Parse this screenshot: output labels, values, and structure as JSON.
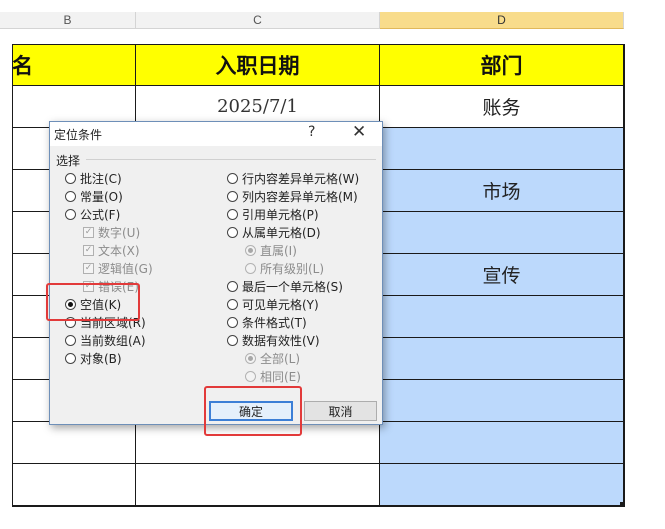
{
  "columns": [
    {
      "letter": "B",
      "selected": false
    },
    {
      "letter": "C",
      "selected": false
    },
    {
      "letter": "D",
      "selected": true
    }
  ],
  "header_row": {
    "b": "名",
    "c": "入职日期",
    "d": "部门"
  },
  "rows": [
    {
      "c": "2025/7/1",
      "d": "账务"
    },
    {
      "c": "",
      "d": ""
    },
    {
      "c": "",
      "d": "市场"
    },
    {
      "c": "",
      "d": ""
    },
    {
      "c": "",
      "d": "宣传"
    },
    {
      "c": "",
      "d": ""
    },
    {
      "c": "",
      "d": ""
    },
    {
      "c": "",
      "d": ""
    },
    {
      "c": "",
      "d": ""
    },
    {
      "c": "",
      "d": ""
    }
  ],
  "dialog": {
    "title": "定位条件",
    "help": "?",
    "close": "✕",
    "group_label": "选择",
    "left_options": [
      {
        "label": "批注(C)",
        "kind": "radio",
        "checked": false,
        "disabled": false
      },
      {
        "label": "常量(O)",
        "kind": "radio",
        "checked": false,
        "disabled": false
      },
      {
        "label": "公式(F)",
        "kind": "radio",
        "checked": false,
        "disabled": false
      },
      {
        "label": "数字(U)",
        "kind": "check",
        "checked": true,
        "disabled": true
      },
      {
        "label": "文本(X)",
        "kind": "check",
        "checked": true,
        "disabled": true
      },
      {
        "label": "逻辑值(G)",
        "kind": "check",
        "checked": true,
        "disabled": true
      },
      {
        "label": "错误(E)",
        "kind": "check",
        "checked": true,
        "disabled": true
      },
      {
        "label": "空值(K)",
        "kind": "radio",
        "checked": true,
        "disabled": false
      },
      {
        "label": "当前区域(R)",
        "kind": "radio",
        "checked": false,
        "disabled": false
      },
      {
        "label": "当前数组(A)",
        "kind": "radio",
        "checked": false,
        "disabled": false
      },
      {
        "label": "对象(B)",
        "kind": "radio",
        "checked": false,
        "disabled": false
      }
    ],
    "right_options": [
      {
        "label": "行内容差异单元格(W)",
        "kind": "radio",
        "checked": false,
        "disabled": false
      },
      {
        "label": "列内容差异单元格(M)",
        "kind": "radio",
        "checked": false,
        "disabled": false
      },
      {
        "label": "引用单元格(P)",
        "kind": "radio",
        "checked": false,
        "disabled": false
      },
      {
        "label": "从属单元格(D)",
        "kind": "radio",
        "checked": false,
        "disabled": false
      },
      {
        "label": "直属(I)",
        "kind": "radio",
        "checked": true,
        "disabled": true
      },
      {
        "label": "所有级别(L)",
        "kind": "radio",
        "checked": false,
        "disabled": true
      },
      {
        "label": "最后一个单元格(S)",
        "kind": "radio",
        "checked": false,
        "disabled": false
      },
      {
        "label": "可见单元格(Y)",
        "kind": "radio",
        "checked": false,
        "disabled": false
      },
      {
        "label": "条件格式(T)",
        "kind": "radio",
        "checked": false,
        "disabled": false
      },
      {
        "label": "数据有效性(V)",
        "kind": "radio",
        "checked": false,
        "disabled": false
      },
      {
        "label": "全部(L)",
        "kind": "radio",
        "checked": true,
        "disabled": true
      },
      {
        "label": "相同(E)",
        "kind": "radio",
        "checked": false,
        "disabled": true
      }
    ],
    "ok_label": "确定",
    "cancel_label": "取消"
  },
  "colors": {
    "header_fill": "#ffff00",
    "selection_fill": "#bcd9fc",
    "highlight_box": "#e23a3a",
    "default_button_border": "#3c7fd6"
  }
}
